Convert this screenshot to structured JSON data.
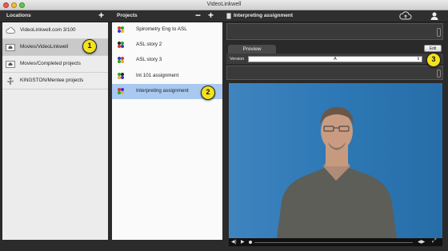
{
  "window": {
    "title": "VideoLinkwell"
  },
  "headers": {
    "locations": "Locations",
    "projects": "Projects",
    "assignment": "Interpreting assignment"
  },
  "locations": [
    {
      "label": "VideoLinkwell.com 3/100",
      "icon": "cloud-icon"
    },
    {
      "label": "Movies/VideoLinkwell",
      "icon": "home-folder-icon"
    },
    {
      "label": "Movies/Completed projects",
      "icon": "home-folder-icon"
    },
    {
      "label": "KINGSTON/Mentee projects",
      "icon": "usb-icon"
    }
  ],
  "projects": [
    {
      "label": "Spirometry Eng to ASL"
    },
    {
      "label": "ASL story 2"
    },
    {
      "label": "ASL story 3"
    },
    {
      "label": "Int 101 assignment"
    },
    {
      "label": "Interpreting assignment"
    }
  ],
  "right": {
    "preview_tab": "Preview",
    "version_label": "Version",
    "version_value": "A",
    "edit_label": "Edit"
  },
  "callouts": [
    "1",
    "2",
    "3"
  ],
  "colors": {
    "selection": "#a9c9f0",
    "callout": "#f3e21c",
    "video_bg": "#2d78b5"
  }
}
